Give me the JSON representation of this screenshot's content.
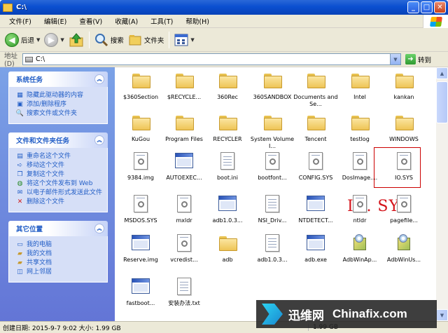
{
  "window": {
    "title": "C:\\",
    "min_label": "_",
    "max_label": "□",
    "close_label": "✕"
  },
  "menu": [
    "文件(F)",
    "编辑(E)",
    "查看(V)",
    "收藏(A)",
    "工具(T)",
    "帮助(H)"
  ],
  "toolbar": {
    "back": "后退",
    "search": "搜索",
    "folders": "文件夹"
  },
  "address": {
    "label": "地址(D)",
    "value": "C:\\",
    "go": "转到"
  },
  "sidebar": {
    "system": {
      "title": "系统任务",
      "items": [
        "隐藏此驱动器的内容",
        "添加/删除程序",
        "搜索文件或文件夹"
      ]
    },
    "file": {
      "title": "文件和文件夹任务",
      "items": [
        "重命名这个文件",
        "移动这个文件",
        "复制这个文件",
        "将这个文件发布到 Web",
        "以电子邮件形式发送此文件",
        "删除这个文件"
      ]
    },
    "other": {
      "title": "其它位置",
      "items": [
        "我的电脑",
        "我的文档",
        "共享文档",
        "网上邻居"
      ]
    }
  },
  "files": [
    {
      "name": "$360Section",
      "type": "folder"
    },
    {
      "name": "$RECYCLE...",
      "type": "folder"
    },
    {
      "name": "360Rec",
      "type": "folder"
    },
    {
      "name": "360SANDBOX",
      "type": "folder"
    },
    {
      "name": "Documents and Se...",
      "type": "folder"
    },
    {
      "name": "Intel",
      "type": "folder"
    },
    {
      "name": "kankan",
      "type": "folder"
    },
    {
      "name": "KuGou",
      "type": "folder"
    },
    {
      "name": "Program Files",
      "type": "folder"
    },
    {
      "name": "RECYCLER",
      "type": "folder"
    },
    {
      "name": "System Volume I...",
      "type": "folder"
    },
    {
      "name": "Tencent",
      "type": "folder"
    },
    {
      "name": "testlog",
      "type": "folder"
    },
    {
      "name": "WINDOWS",
      "type": "folder"
    },
    {
      "name": "9384.img",
      "type": "sys"
    },
    {
      "name": "AUTOEXEC...",
      "type": "app"
    },
    {
      "name": "boot.ini",
      "type": "doc"
    },
    {
      "name": "bootfont...",
      "type": "sys"
    },
    {
      "name": "CONFIG.SYS",
      "type": "sys"
    },
    {
      "name": "DosImage....",
      "type": "sys"
    },
    {
      "name": "IO.SYS",
      "type": "sys"
    },
    {
      "name": "MSDOS.SYS",
      "type": "sys"
    },
    {
      "name": "mxldr",
      "type": "sys"
    },
    {
      "name": "adb1.0.3...",
      "type": "app"
    },
    {
      "name": "NSI_Driv...",
      "type": "doc"
    },
    {
      "name": "NTDETECT...",
      "type": "app"
    },
    {
      "name": "ntldr",
      "type": "sys"
    },
    {
      "name": "pagefile...",
      "type": "sys"
    },
    {
      "name": "Reserve.img",
      "type": "app"
    },
    {
      "name": "vcredist...",
      "type": "sys"
    },
    {
      "name": "adb",
      "type": "folder"
    },
    {
      "name": "adb1.0.3...",
      "type": "doc"
    },
    {
      "name": "adb.exe",
      "type": "app"
    },
    {
      "name": "AdbWinAp...",
      "type": "setup"
    },
    {
      "name": "AdbWinUs...",
      "type": "setup"
    },
    {
      "name": "fastboot...",
      "type": "app"
    },
    {
      "name": "安装办法.txt",
      "type": "doc"
    }
  ],
  "overlay_label": "IO. SYS",
  "watermark": {
    "cn": "迅维网",
    "en": "Chinafix.com"
  },
  "status": {
    "left": "创建日期: 2015-9-7 9:02 大小: 1.99 GB",
    "right": "1.99 GB"
  }
}
